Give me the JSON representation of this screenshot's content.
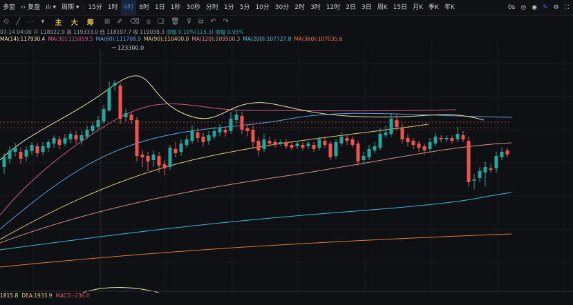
{
  "toolbar": {
    "left_label": "多窗",
    "replay_label": "复盘",
    "period_label": "周期",
    "intervals": [
      "15分",
      "1时",
      "4时",
      "8时",
      "1日",
      "1秒",
      "30秒",
      "分时",
      "1分",
      "5分",
      "10分",
      "30分",
      "2时",
      "3时",
      "12时",
      "2日",
      "3日",
      "周K",
      "15日",
      "月K",
      "季K",
      "年K"
    ],
    "active_interval": "4时",
    "right_items": [
      "0s"
    ]
  },
  "drawbar": {
    "indicators": [
      "主",
      "大",
      "筹"
    ]
  },
  "ohlc": {
    "date": "07-14 04:00",
    "open": "开 118922.9",
    "high": "高 119333.0",
    "low": "低 118197.7",
    "close": "收 119038.3",
    "change": "涨幅 0.10%(115.3)",
    "amplitude": "振幅 0.95%"
  },
  "ma_legend": [
    {
      "label": "MA(14):117930.4",
      "color": "#e8e4a8"
    },
    {
      "label": "MA(30):115059.5",
      "color": "#d35a8a"
    },
    {
      "label": "MA(60):111708.9",
      "color": "#5aa0e0"
    },
    {
      "label": "MA(90):110400.0",
      "color": "#e3cb78"
    },
    {
      "label": "MA(120):109500.3",
      "color": "#d98f8f"
    },
    {
      "label": "MA(200):107727.8",
      "color": "#3fbcd6"
    },
    {
      "label": "MA(360):107035.6",
      "color": "#e07a3c"
    }
  ],
  "macd_legend": [
    {
      "label": "1815.8",
      "color": "#e8e4a8"
    },
    {
      "label": "DEA:1933.9",
      "color": "#e3cb78"
    },
    {
      "label": "MACD:-236.0",
      "color": "#d35a5a"
    }
  ],
  "annotation": "123300.0",
  "colors": {
    "up": "#26a69a",
    "down": "#ef5350",
    "background": "#0f1014"
  },
  "chart_data": {
    "type": "candlestick",
    "interval": "4时",
    "max_marker": 123300.0,
    "ylim": [
      104500,
      123800
    ],
    "moving_averages": [
      "MA(14)",
      "MA(30)",
      "MA(60)",
      "MA(90)",
      "MA(120)",
      "MA(200)",
      "MA(360)"
    ]
  }
}
